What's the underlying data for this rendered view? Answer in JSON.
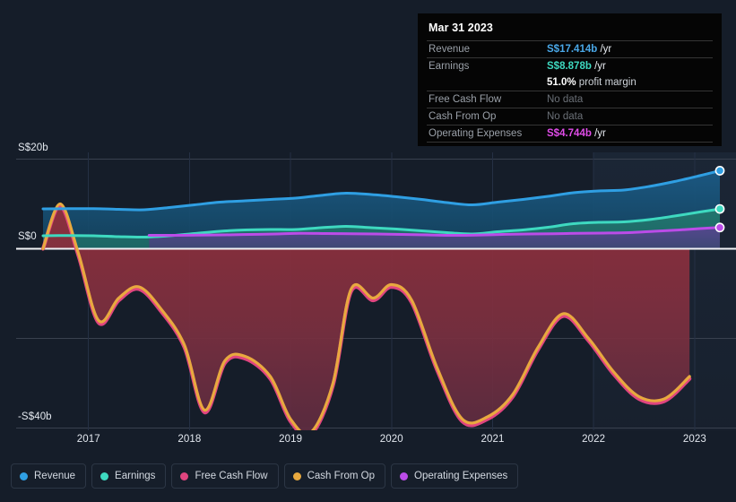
{
  "chart_data": {
    "type": "area",
    "title": "",
    "xlabel": "",
    "ylabel": "",
    "currency": "S$",
    "x_tick_labels": [
      "2017",
      "2018",
      "2019",
      "2020",
      "2021",
      "2022",
      "2023"
    ],
    "y_tick_labels": [
      "S$20b",
      "S$0",
      "-S$40b"
    ],
    "ylim": [
      -40,
      20
    ],
    "y_gridlines": [
      20,
      0,
      -20,
      -40
    ],
    "grid": true,
    "legend_position": "bottom-left",
    "zero_line": true,
    "forecast_band_start": "2022",
    "series": [
      {
        "name": "Revenue",
        "color": "#2f9fe3",
        "fill": true,
        "last_value": 17.414,
        "last_label": "S$17.414b",
        "x": [
          2016.55,
          2016.8,
          2017.05,
          2017.3,
          2017.55,
          2017.8,
          2018.05,
          2018.3,
          2018.55,
          2018.8,
          2019.05,
          2019.3,
          2019.55,
          2019.8,
          2020.05,
          2020.3,
          2020.55,
          2020.8,
          2021.05,
          2021.3,
          2021.55,
          2021.8,
          2022.05,
          2022.3,
          2022.55,
          2022.8,
          2023.05,
          2023.25
        ],
        "y": [
          8.9,
          8.95,
          8.95,
          8.8,
          8.7,
          9.2,
          9.8,
          10.4,
          10.7,
          11.0,
          11.3,
          11.9,
          12.4,
          12.1,
          11.6,
          11.0,
          10.3,
          9.8,
          10.4,
          11.0,
          11.7,
          12.5,
          12.9,
          13.1,
          13.9,
          15.0,
          16.3,
          17.414
        ]
      },
      {
        "name": "Earnings",
        "color": "#3ed9c0",
        "fill": true,
        "last_value": 8.878,
        "last_label": "S$8.878b",
        "x": [
          2016.55,
          2016.8,
          2017.05,
          2017.3,
          2017.55,
          2017.8,
          2018.05,
          2018.3,
          2018.55,
          2018.8,
          2019.05,
          2019.3,
          2019.55,
          2019.8,
          2020.05,
          2020.3,
          2020.55,
          2020.8,
          2021.05,
          2021.3,
          2021.55,
          2021.8,
          2022.05,
          2022.3,
          2022.55,
          2022.8,
          2023.05,
          2023.25
        ],
        "y": [
          2.9,
          2.95,
          2.9,
          2.7,
          2.6,
          2.9,
          3.4,
          3.9,
          4.2,
          4.3,
          4.3,
          4.7,
          5.0,
          4.7,
          4.4,
          4.0,
          3.6,
          3.3,
          3.8,
          4.2,
          4.8,
          5.6,
          5.9,
          6.0,
          6.5,
          7.3,
          8.2,
          8.878
        ]
      },
      {
        "name": "Free Cash Flow",
        "color": "#e0457f",
        "fill": false,
        "last_value": null,
        "last_label": "No data",
        "x": [
          2016.55,
          2016.72,
          2016.9,
          2017.1,
          2017.3,
          2017.5,
          2017.72,
          2017.95,
          2018.15,
          2018.35,
          2018.55,
          2018.8,
          2019.0,
          2019.2,
          2019.42,
          2019.6,
          2019.82,
          2020.0,
          2020.2,
          2020.45,
          2020.7,
          2020.95,
          2021.2,
          2021.45,
          2021.7,
          2021.95,
          2022.2,
          2022.45,
          2022.7,
          2022.95
        ],
        "y": [
          0.0,
          9.5,
          -1.5,
          -16.5,
          -11.5,
          -9.0,
          -14.0,
          -22.0,
          -36.5,
          -25.5,
          -24.5,
          -29.0,
          -38.5,
          -41.5,
          -30.5,
          -9.5,
          -11.5,
          -8.5,
          -12.0,
          -27.0,
          -38.5,
          -38.0,
          -33.0,
          -22.5,
          -15.0,
          -20.5,
          -28.0,
          -33.5,
          -34.0,
          -29.0
        ]
      },
      {
        "name": "Cash From Op",
        "color": "#e8a93f",
        "fill": false,
        "last_value": null,
        "last_label": "No data",
        "x": [
          2016.55,
          2016.72,
          2016.9,
          2017.1,
          2017.3,
          2017.5,
          2017.72,
          2017.95,
          2018.15,
          2018.35,
          2018.55,
          2018.8,
          2019.0,
          2019.2,
          2019.42,
          2019.6,
          2019.82,
          2020.0,
          2020.2,
          2020.45,
          2020.7,
          2020.95,
          2021.2,
          2021.45,
          2021.7,
          2021.95,
          2022.2,
          2022.45,
          2022.7,
          2022.95
        ],
        "y": [
          0.0,
          10.0,
          -1.0,
          -16.0,
          -11.0,
          -8.5,
          -13.5,
          -21.5,
          -36.0,
          -25.0,
          -24.0,
          -28.5,
          -38.0,
          -41.0,
          -30.0,
          -9.0,
          -11.0,
          -8.0,
          -11.5,
          -26.5,
          -38.0,
          -37.5,
          -32.5,
          -22.0,
          -14.5,
          -20.0,
          -27.5,
          -33.0,
          -33.5,
          -28.5
        ]
      },
      {
        "name": "Operating Expenses",
        "color": "#bb4ce8",
        "fill": true,
        "last_value": 4.744,
        "last_label": "S$4.744b",
        "x": [
          2017.6,
          2017.85,
          2018.1,
          2018.35,
          2018.6,
          2018.85,
          2019.1,
          2019.35,
          2019.6,
          2019.85,
          2020.1,
          2020.35,
          2020.6,
          2020.85,
          2021.1,
          2021.35,
          2021.6,
          2021.85,
          2022.1,
          2022.35,
          2022.6,
          2022.85,
          2023.05,
          2023.25
        ],
        "y": [
          3.0,
          3.0,
          3.05,
          3.1,
          3.2,
          3.3,
          3.45,
          3.4,
          3.35,
          3.3,
          3.2,
          3.1,
          3.0,
          3.05,
          3.2,
          3.3,
          3.35,
          3.45,
          3.5,
          3.6,
          3.9,
          4.2,
          4.5,
          4.744
        ]
      }
    ]
  },
  "tooltip": {
    "date": "Mar 31 2023",
    "rows": [
      {
        "key": "Revenue",
        "value": "S$17.414b",
        "unit": " /yr",
        "color": "#4aa8e8",
        "nodata": false
      },
      {
        "key": "Earnings",
        "value": "S$8.878b",
        "unit": " /yr",
        "color": "#3ed9c0",
        "nodata": false
      },
      {
        "key": "",
        "value": "51.0%",
        "unit": " profit margin",
        "color": "#ffffff",
        "nodata": false,
        "margin": true
      },
      {
        "key": "Free Cash Flow",
        "value": "No data",
        "unit": "",
        "color": "#6b7077",
        "nodata": true
      },
      {
        "key": "Cash From Op",
        "value": "No data",
        "unit": "",
        "color": "#6b7077",
        "nodata": true
      },
      {
        "key": "Operating Expenses",
        "value": "S$4.744b",
        "unit": " /yr",
        "color": "#e04ce8",
        "nodata": false
      }
    ]
  },
  "legend": {
    "items": [
      {
        "label": "Revenue",
        "color": "#2f9fe3"
      },
      {
        "label": "Earnings",
        "color": "#3ed9c0"
      },
      {
        "label": "Free Cash Flow",
        "color": "#e0457f"
      },
      {
        "label": "Cash From Op",
        "color": "#e8a93f"
      },
      {
        "label": "Operating Expenses",
        "color": "#bb4ce8"
      }
    ]
  },
  "theme": {
    "background": "#151d29",
    "grid": "#39414f",
    "zero_line": "#f2f4f7",
    "negative_fill": "#8a2f3f"
  }
}
